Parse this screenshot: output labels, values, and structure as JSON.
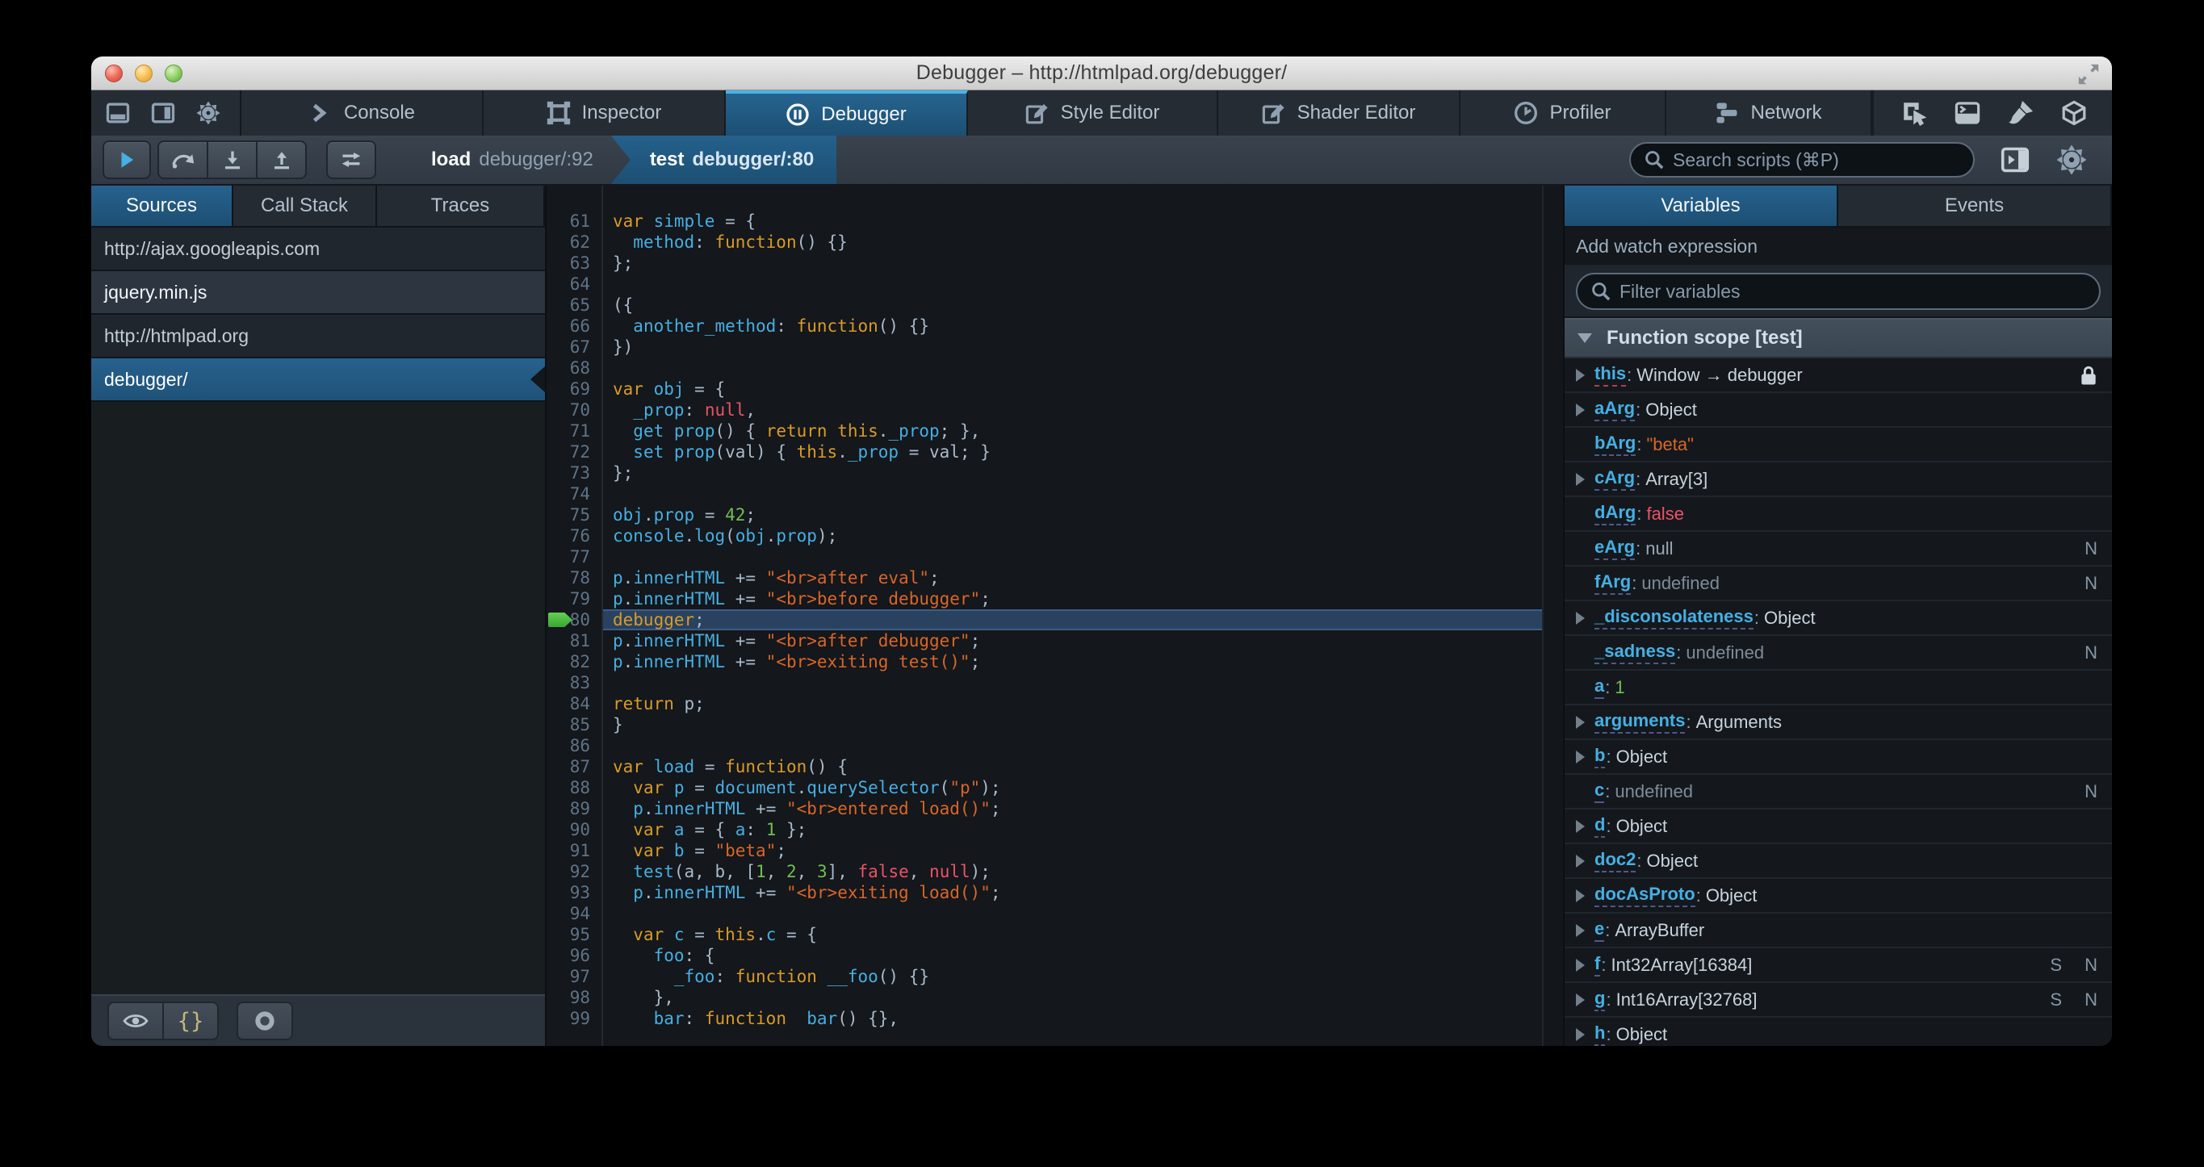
{
  "window": {
    "title": "Debugger – http://htmlpad.org/debugger/",
    "traffic_lights": [
      "close",
      "minimize",
      "zoom"
    ]
  },
  "colors": {
    "selection_blue": "#1d4f73",
    "accent_blue": "#46afe3",
    "keyword": "#d99b28",
    "string": "#d96629",
    "number": "#70bf53",
    "red_literal": "#eb5368",
    "body_background": "#14171b",
    "tab_background": "#252c33"
  },
  "toolbox": {
    "left_icons": [
      {
        "id": "dock-bottom",
        "name": "dock-bottom-icon"
      },
      {
        "id": "dock-side",
        "name": "dock-side-icon"
      },
      {
        "id": "gear",
        "name": "toolbox-options-icon"
      }
    ],
    "tabs": [
      {
        "id": "console",
        "label": "Console",
        "active": false
      },
      {
        "id": "inspector",
        "label": "Inspector",
        "active": false
      },
      {
        "id": "debugger",
        "label": "Debugger",
        "active": true
      },
      {
        "id": "style-editor",
        "label": "Style Editor",
        "active": false
      },
      {
        "id": "shader-editor",
        "label": "Shader Editor",
        "active": false
      },
      {
        "id": "profiler",
        "label": "Profiler",
        "active": false
      },
      {
        "id": "network",
        "label": "Network",
        "active": false
      }
    ],
    "right_icons": [
      {
        "id": "pick",
        "name": "pick-element-icon"
      },
      {
        "id": "split-console",
        "name": "split-console-icon"
      },
      {
        "id": "paintbrush",
        "name": "paintbrush-icon"
      },
      {
        "id": "tilt",
        "name": "tilt-3d-icon"
      },
      {
        "id": "scratchpad",
        "name": "scratchpad-icon"
      },
      {
        "id": "responsive",
        "name": "responsive-mode-icon"
      }
    ]
  },
  "toolbar": {
    "breadcrumbs": [
      {
        "fn": "load",
        "source": "debugger/:92",
        "active": false
      },
      {
        "fn": "test",
        "source": "debugger/:80",
        "active": true
      }
    ],
    "search": {
      "placeholder": "Search scripts (⌘P)"
    },
    "right_icons": [
      {
        "id": "expand-panes",
        "name": "expand-panes-icon"
      },
      {
        "id": "gear",
        "name": "debugger-options-icon"
      }
    ]
  },
  "sources_panel": {
    "tabs": [
      {
        "label": "Sources",
        "active": true
      },
      {
        "label": "Call Stack",
        "active": false
      },
      {
        "label": "Traces",
        "active": false
      }
    ],
    "items": [
      {
        "label": "http://ajax.googleapis.com",
        "type": "group",
        "selected": false
      },
      {
        "label": "jquery.min.js",
        "type": "source",
        "selected": false
      },
      {
        "label": "http://htmlpad.org",
        "type": "group",
        "selected": false
      },
      {
        "label": "debugger/",
        "type": "source",
        "selected": true
      }
    ],
    "footer_buttons": [
      {
        "id": "eye",
        "name": "blackbox-source-button"
      },
      {
        "id": "braces",
        "name": "prettify-source-button",
        "glyph": "{}"
      },
      {
        "id": "pause-circle",
        "name": "pause-on-exceptions-button"
      }
    ]
  },
  "editor": {
    "first_line": 61,
    "current_line": 80,
    "lines": [
      [
        [
          "k",
          "var"
        ],
        [
          "o",
          " "
        ],
        [
          "i",
          "simple"
        ],
        [
          "o",
          " = {"
        ]
      ],
      [
        [
          "o",
          "  "
        ],
        [
          "i",
          "method"
        ],
        [
          "o",
          ": "
        ],
        [
          "k",
          "function"
        ],
        [
          "o",
          "() {}"
        ]
      ],
      [
        [
          "o",
          "};"
        ]
      ],
      [],
      [
        [
          "o",
          "({"
        ]
      ],
      [
        [
          "o",
          "  "
        ],
        [
          "i",
          "another_method"
        ],
        [
          "o",
          ": "
        ],
        [
          "k",
          "function"
        ],
        [
          "o",
          "() {}"
        ]
      ],
      [
        [
          "o",
          "})"
        ]
      ],
      [],
      [
        [
          "k",
          "var"
        ],
        [
          "o",
          " "
        ],
        [
          "i",
          "obj"
        ],
        [
          "o",
          " = {"
        ]
      ],
      [
        [
          "o",
          "  "
        ],
        [
          "i",
          "_prop"
        ],
        [
          "o",
          ": "
        ],
        [
          "r",
          "null"
        ],
        [
          "o",
          ","
        ]
      ],
      [
        [
          "o",
          "  "
        ],
        [
          "i",
          "get"
        ],
        [
          "o",
          " "
        ],
        [
          "i",
          "prop"
        ],
        [
          "o",
          "() { "
        ],
        [
          "k",
          "return"
        ],
        [
          "o",
          " "
        ],
        [
          "k",
          "this"
        ],
        [
          "o",
          "."
        ],
        [
          "i",
          "_prop"
        ],
        [
          "o",
          "; },"
        ]
      ],
      [
        [
          "o",
          "  "
        ],
        [
          "i",
          "set"
        ],
        [
          "o",
          " "
        ],
        [
          "i",
          "prop"
        ],
        [
          "o",
          "(val) { "
        ],
        [
          "k",
          "this"
        ],
        [
          "o",
          "."
        ],
        [
          "i",
          "_prop"
        ],
        [
          "o",
          " = val; }"
        ]
      ],
      [
        [
          "o",
          "};"
        ]
      ],
      [],
      [
        [
          "i",
          "obj"
        ],
        [
          "o",
          "."
        ],
        [
          "i",
          "prop"
        ],
        [
          "o",
          " = "
        ],
        [
          "n",
          "42"
        ],
        [
          "o",
          ";"
        ]
      ],
      [
        [
          "i",
          "console"
        ],
        [
          "o",
          "."
        ],
        [
          "i",
          "log"
        ],
        [
          "o",
          "("
        ],
        [
          "i",
          "obj"
        ],
        [
          "o",
          "."
        ],
        [
          "i",
          "prop"
        ],
        [
          "o",
          ");"
        ]
      ],
      [],
      [
        [
          "i",
          "p"
        ],
        [
          "o",
          "."
        ],
        [
          "i",
          "innerHTML"
        ],
        [
          "o",
          " += "
        ],
        [
          "s",
          "\"<br>after eval\""
        ],
        [
          "o",
          ";"
        ]
      ],
      [
        [
          "i",
          "p"
        ],
        [
          "o",
          "."
        ],
        [
          "i",
          "innerHTML"
        ],
        [
          "o",
          " += "
        ],
        [
          "s",
          "\"<br>before debugger\""
        ],
        [
          "o",
          ";"
        ]
      ],
      [
        [
          "k",
          "debugger"
        ],
        [
          "o",
          ";"
        ]
      ],
      [
        [
          "i",
          "p"
        ],
        [
          "o",
          "."
        ],
        [
          "i",
          "innerHTML"
        ],
        [
          "o",
          " += "
        ],
        [
          "s",
          "\"<br>after debugger\""
        ],
        [
          "o",
          ";"
        ]
      ],
      [
        [
          "i",
          "p"
        ],
        [
          "o",
          "."
        ],
        [
          "i",
          "innerHTML"
        ],
        [
          "o",
          " += "
        ],
        [
          "s",
          "\"<br>exiting test()\""
        ],
        [
          "o",
          ";"
        ]
      ],
      [],
      [
        [
          "k",
          "return"
        ],
        [
          "o",
          " p;"
        ]
      ],
      [
        [
          "o",
          "}"
        ]
      ],
      [],
      [
        [
          "k",
          "var"
        ],
        [
          "o",
          " "
        ],
        [
          "i",
          "load"
        ],
        [
          "o",
          " = "
        ],
        [
          "k",
          "function"
        ],
        [
          "o",
          "() {"
        ]
      ],
      [
        [
          "o",
          "  "
        ],
        [
          "k",
          "var"
        ],
        [
          "o",
          " "
        ],
        [
          "i",
          "p"
        ],
        [
          "o",
          " = "
        ],
        [
          "i",
          "document"
        ],
        [
          "o",
          "."
        ],
        [
          "i",
          "querySelector"
        ],
        [
          "o",
          "("
        ],
        [
          "s",
          "\"p\""
        ],
        [
          "o",
          ");"
        ]
      ],
      [
        [
          "o",
          "  "
        ],
        [
          "i",
          "p"
        ],
        [
          "o",
          "."
        ],
        [
          "i",
          "innerHTML"
        ],
        [
          "o",
          " += "
        ],
        [
          "s",
          "\"<br>entered load()\""
        ],
        [
          "o",
          ";"
        ]
      ],
      [
        [
          "o",
          "  "
        ],
        [
          "k",
          "var"
        ],
        [
          "o",
          " "
        ],
        [
          "i",
          "a"
        ],
        [
          "o",
          " = { "
        ],
        [
          "i",
          "a"
        ],
        [
          "o",
          ": "
        ],
        [
          "n",
          "1"
        ],
        [
          "o",
          " };"
        ]
      ],
      [
        [
          "o",
          "  "
        ],
        [
          "k",
          "var"
        ],
        [
          "o",
          " "
        ],
        [
          "i",
          "b"
        ],
        [
          "o",
          " = "
        ],
        [
          "s",
          "\"beta\""
        ],
        [
          "o",
          ";"
        ]
      ],
      [
        [
          "o",
          "  "
        ],
        [
          "i",
          "test"
        ],
        [
          "o",
          "(a, b, ["
        ],
        [
          "n",
          "1"
        ],
        [
          "o",
          ", "
        ],
        [
          "n",
          "2"
        ],
        [
          "o",
          ", "
        ],
        [
          "n",
          "3"
        ],
        [
          "o",
          "], "
        ],
        [
          "r",
          "false"
        ],
        [
          "o",
          ", "
        ],
        [
          "r",
          "null"
        ],
        [
          "o",
          ");"
        ]
      ],
      [
        [
          "o",
          "  "
        ],
        [
          "i",
          "p"
        ],
        [
          "o",
          "."
        ],
        [
          "i",
          "innerHTML"
        ],
        [
          "o",
          " += "
        ],
        [
          "s",
          "\"<br>exiting load()\""
        ],
        [
          "o",
          ";"
        ]
      ],
      [],
      [
        [
          "o",
          "  "
        ],
        [
          "k",
          "var"
        ],
        [
          "o",
          " "
        ],
        [
          "i",
          "c"
        ],
        [
          "o",
          " = "
        ],
        [
          "k",
          "this"
        ],
        [
          "o",
          "."
        ],
        [
          "i",
          "c"
        ],
        [
          "o",
          " = {"
        ]
      ],
      [
        [
          "o",
          "    "
        ],
        [
          "i",
          "foo"
        ],
        [
          "o",
          ": {"
        ]
      ],
      [
        [
          "o",
          "      "
        ],
        [
          "i",
          "_foo"
        ],
        [
          "o",
          ": "
        ],
        [
          "k",
          "function"
        ],
        [
          "o",
          " "
        ],
        [
          "i",
          "__foo"
        ],
        [
          "o",
          "() {}"
        ]
      ],
      [
        [
          "o",
          "    },"
        ]
      ],
      [
        [
          "o",
          "    "
        ],
        [
          "i",
          "bar"
        ],
        [
          "o",
          ": "
        ],
        [
          "k",
          "function"
        ],
        [
          "o",
          "  "
        ],
        [
          "i",
          "bar"
        ],
        [
          "o",
          "() {},"
        ]
      ]
    ]
  },
  "variables_panel": {
    "tabs": [
      {
        "label": "Variables",
        "active": true
      },
      {
        "label": "Events",
        "active": false
      }
    ],
    "watch_label": "Add watch expression",
    "filter_placeholder": "Filter variables",
    "scope": {
      "label": "Function scope [test]",
      "expanded": true
    },
    "variables": [
      {
        "name": "this",
        "value": "Window → debugger",
        "type": "obj",
        "expandable": true,
        "underline": "red",
        "lock": true,
        "badges": []
      },
      {
        "name": "aArg",
        "value": "Object",
        "type": "obj",
        "expandable": true,
        "badges": []
      },
      {
        "name": "bArg",
        "value": "\"beta\"",
        "type": "str",
        "expandable": false,
        "badges": []
      },
      {
        "name": "cArg",
        "value": "Array[3]",
        "type": "obj",
        "expandable": true,
        "badges": []
      },
      {
        "name": "dArg",
        "value": "false",
        "type": "bool",
        "expandable": false,
        "badges": []
      },
      {
        "name": "eArg",
        "value": "null",
        "type": "null",
        "expandable": false,
        "badges": [
          "N"
        ]
      },
      {
        "name": "fArg",
        "value": "undefined",
        "type": "undef",
        "expandable": false,
        "badges": [
          "N"
        ]
      },
      {
        "name": "_disconsolateness",
        "value": "Object",
        "type": "obj",
        "expandable": true,
        "badges": []
      },
      {
        "name": "_sadness",
        "value": "undefined",
        "type": "undef",
        "expandable": false,
        "badges": [
          "N"
        ]
      },
      {
        "name": "a",
        "value": "1",
        "type": "num",
        "expandable": false,
        "badges": []
      },
      {
        "name": "arguments",
        "value": "Arguments",
        "type": "obj",
        "expandable": true,
        "badges": []
      },
      {
        "name": "b",
        "value": "Object",
        "type": "obj",
        "expandable": true,
        "badges": []
      },
      {
        "name": "c",
        "value": "undefined",
        "type": "undef",
        "expandable": false,
        "badges": [
          "N"
        ]
      },
      {
        "name": "d",
        "value": "Object",
        "type": "obj",
        "expandable": true,
        "badges": []
      },
      {
        "name": "doc2",
        "value": "Object",
        "type": "obj",
        "expandable": true,
        "badges": []
      },
      {
        "name": "docAsProto",
        "value": "Object",
        "type": "obj",
        "expandable": true,
        "badges": []
      },
      {
        "name": "e",
        "value": "ArrayBuffer",
        "type": "obj",
        "expandable": true,
        "badges": []
      },
      {
        "name": "f",
        "value": "Int32Array[16384]",
        "type": "obj",
        "expandable": true,
        "badges": [
          "S",
          "N"
        ]
      },
      {
        "name": "g",
        "value": "Int16Array[32768]",
        "type": "obj",
        "expandable": true,
        "badges": [
          "S",
          "N"
        ]
      },
      {
        "name": "h",
        "value": "Object",
        "type": "obj",
        "expandable": true,
        "badges": []
      }
    ]
  }
}
